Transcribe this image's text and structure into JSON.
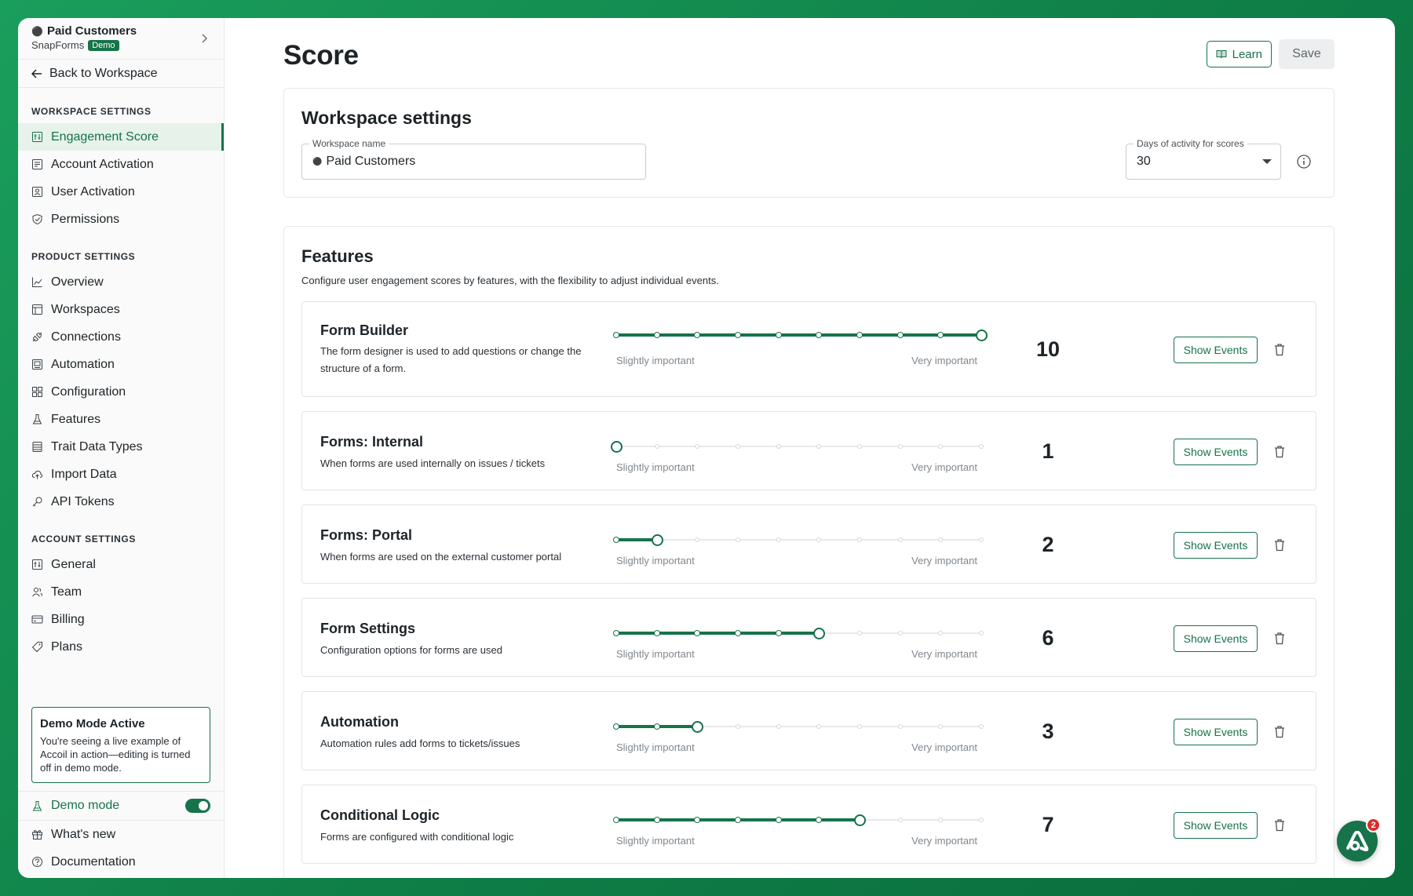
{
  "workspace": {
    "name": "Paid Customers",
    "org": "SnapForms",
    "badge": "Demo",
    "back_label": "Back to Workspace"
  },
  "sidebar": {
    "workspace_settings_title": "WORKSPACE SETTINGS",
    "workspace_items": [
      "Engagement Score",
      "Account Activation",
      "User Activation",
      "Permissions"
    ],
    "product_settings_title": "PRODUCT SETTINGS",
    "product_items": [
      "Overview",
      "Workspaces",
      "Connections",
      "Automation",
      "Configuration",
      "Features",
      "Trait Data Types",
      "Import Data",
      "API Tokens"
    ],
    "account_settings_title": "ACCOUNT SETTINGS",
    "account_items": [
      "General",
      "Team",
      "Billing",
      "Plans"
    ],
    "demo_box": {
      "title": "Demo Mode Active",
      "text": "You're seeing a live example of Accoil in action—editing is turned off in demo mode."
    },
    "demo_mode_label": "Demo mode",
    "demo_mode_on": true,
    "whats_new": "What's new",
    "documentation": "Documentation"
  },
  "header": {
    "title": "Score",
    "learn_label": "Learn",
    "save_label": "Save"
  },
  "workspace_settings": {
    "title": "Workspace settings",
    "name_label": "Workspace name",
    "name_value": "Paid Customers",
    "days_label": "Days of activity for scores",
    "days_value": "30"
  },
  "features": {
    "title": "Features",
    "subtitle": "Configure user engagement scores by features, with the flexibility to adjust individual events.",
    "slider_low": "Slightly important",
    "slider_high": "Very important",
    "show_events_label": "Show Events",
    "max_score": 10,
    "items": [
      {
        "name": "Form Builder",
        "desc": "The form designer is used to add questions or change the structure of a form.",
        "score": "10"
      },
      {
        "name": "Forms: Internal",
        "desc": "When forms are used internally on issues / tickets",
        "score": "1"
      },
      {
        "name": "Forms: Portal",
        "desc": "When forms are used on the external customer portal",
        "score": "2"
      },
      {
        "name": "Form Settings",
        "desc": "Configuration options for forms are used",
        "score": "6"
      },
      {
        "name": "Automation",
        "desc": "Automation rules add forms to tickets/issues",
        "score": "3"
      },
      {
        "name": "Conditional Logic",
        "desc": "Forms are configured with conditional logic",
        "score": "7"
      }
    ]
  },
  "notifications": {
    "count": "2"
  },
  "colors": {
    "accent": "#16734a",
    "background_green": "#12904f"
  }
}
